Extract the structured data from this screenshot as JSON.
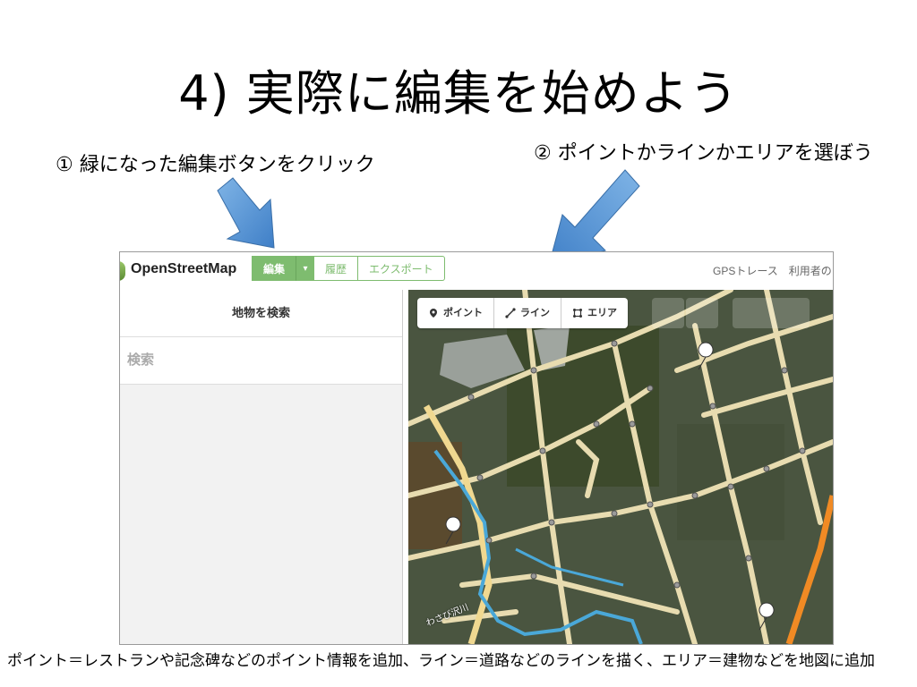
{
  "slide": {
    "title": "4)   実際に編集を始めよう",
    "step1": "① 緑になった編集ボタンをクリック",
    "step2": "② ポイントかラインかエリアを選ぼう",
    "caption": "ポイント＝レストランや記念碑などのポイント情報を追加、ライン＝道路などのラインを描く、エリア＝建物などを地図に追加"
  },
  "osm": {
    "brand": "OpenStreetMap",
    "tabs": {
      "edit": "編集",
      "caret": "▾",
      "history": "履歴",
      "export": "エクスポート"
    },
    "nav_right": "GPSトレース　利用者の",
    "sidebar": {
      "heading": "地物を検索",
      "search_placeholder": "検索"
    },
    "tools": [
      {
        "label": "ポイント",
        "icon": "map-pin-icon"
      },
      {
        "label": "ライン",
        "icon": "line-icon"
      },
      {
        "label": "エリア",
        "icon": "area-icon"
      }
    ],
    "map_label": "わさび沢川"
  },
  "colors": {
    "accent_green": "#7ebc6f",
    "arrow_blue": "#5b9bd5",
    "road": "#e8dcb0",
    "river": "#4aa8d8",
    "major_road": "#f08a24"
  }
}
